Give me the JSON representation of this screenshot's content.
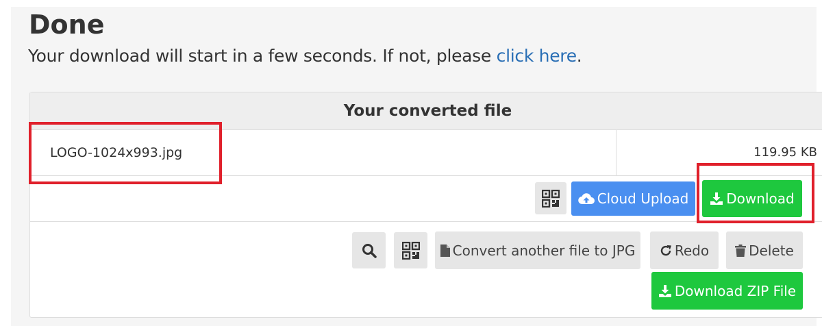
{
  "header": {
    "title": "Done",
    "notice_text": "Your download will start in a few seconds. If not, please ",
    "notice_link": "click here",
    "notice_end": "."
  },
  "panel": {
    "heading": "Your converted file",
    "file": {
      "name": "LOGO-1024x993.jpg",
      "size": "119.95 KB"
    },
    "actions": {
      "cloud_upload_label": "Cloud Upload",
      "download_label": "Download"
    },
    "more_actions": {
      "convert_label": "Convert another file to JPG",
      "redo_label": "Redo",
      "delete_label": "Delete",
      "zip_label": "Download ZIP File"
    }
  },
  "colors": {
    "accent_blue": "#4a8ff0",
    "accent_green": "#1ec83e",
    "highlight_red": "#e0202b",
    "link": "#2a6fb5"
  },
  "icons": [
    "qr-code-icon",
    "cloud-upload-icon",
    "download-icon",
    "search-icon",
    "file-icon",
    "redo-icon",
    "trash-icon"
  ]
}
